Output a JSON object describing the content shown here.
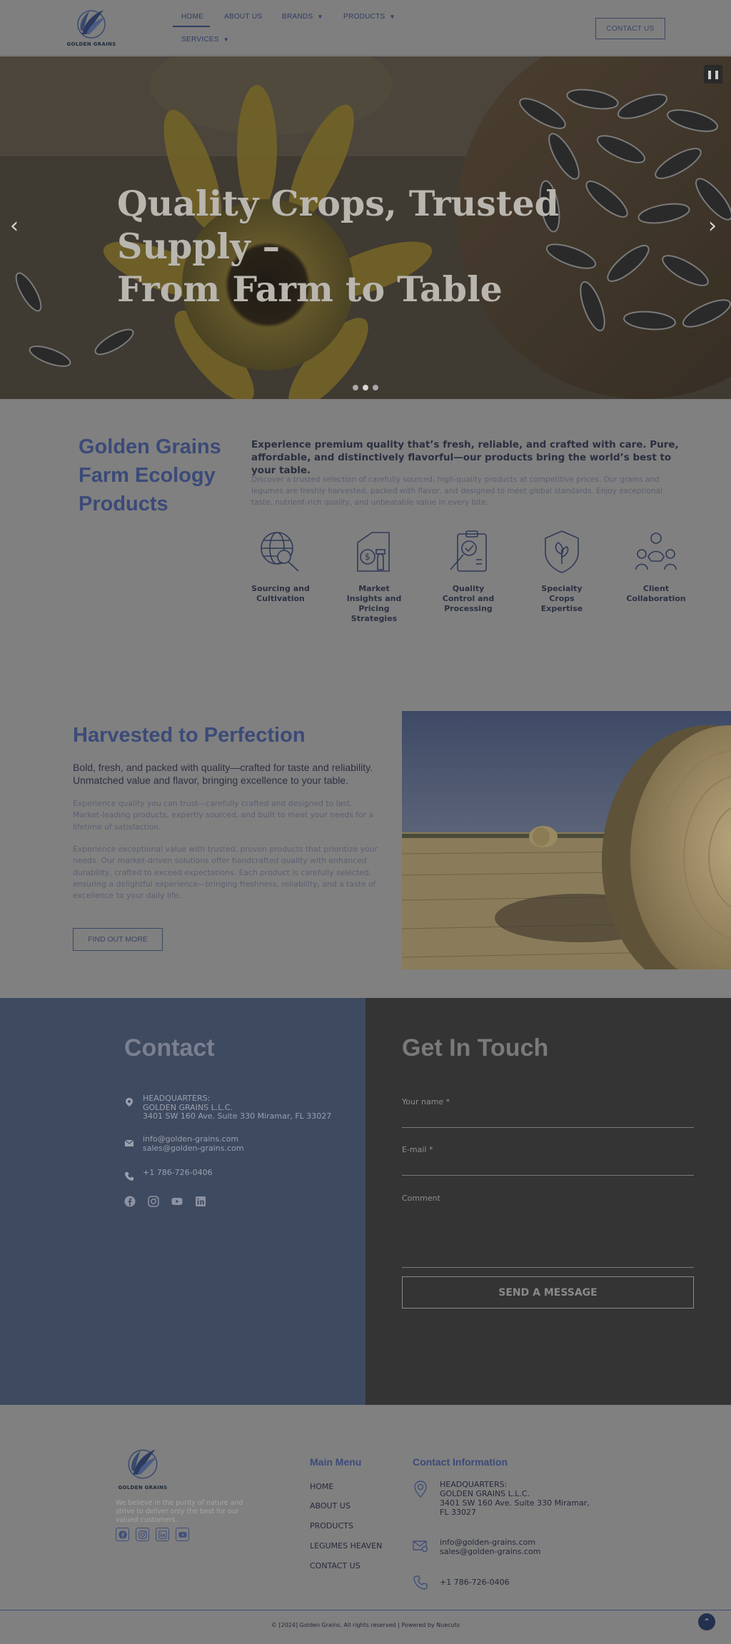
{
  "brand": {
    "name": "GOLDEN GRAINS"
  },
  "nav": {
    "items": [
      {
        "label": "HOME",
        "active": true,
        "has_dropdown": false
      },
      {
        "label": "ABOUT US",
        "has_dropdown": false
      },
      {
        "label": "BRANDS",
        "has_dropdown": true
      },
      {
        "label": "PRODUCTS",
        "has_dropdown": true
      },
      {
        "label": "SERVICES",
        "has_dropdown": true
      }
    ],
    "contact_button": "CONTACT US"
  },
  "hero": {
    "title_line1": "Quality Crops, Trusted Supply –",
    "title_line2": "From Farm to Table",
    "pause_icon": "pause-icon",
    "slides": 3,
    "active_slide": 2
  },
  "about": {
    "heading_line1": "Golden Grains",
    "heading_line2": "Farm Ecology",
    "heading_line3": "Products",
    "lead": "Experience premium quality that’s fresh, reliable, and crafted with care. Pure, affordable, and distinctively flavorful—our products bring the world’s best to your table.",
    "body": "Discover a trusted selection of carefully sourced, high-quality products at competitive prices. Our grains and legumes are freshly harvested, packed with flavor, and designed to meet global standards. Enjoy exceptional taste, nutrient-rich quality, and unbeatable value in every bite.",
    "features": [
      {
        "label": "Sourcing and Cultivation",
        "icon": "globe-sourcing-icon"
      },
      {
        "label": "Market Insights and Pricing Strategies",
        "icon": "market-strategy-icon"
      },
      {
        "label": "Quality Control and Processing",
        "icon": "quality-checklist-icon"
      },
      {
        "label": "Specialty Crops Expertise",
        "icon": "shield-leaf-icon"
      },
      {
        "label": "Client Collaboration",
        "icon": "client-collaboration-icon"
      }
    ]
  },
  "harvest": {
    "title": "Harvested to Perfection",
    "subtitle": "Bold, fresh, and packed with quality—crafted for taste and reliability. Unmatched value and flavor, bringing excellence to your table.",
    "paragraph1": "Experience quality you can trust—carefully crafted and designed to last. Market-leading products, expertly sourced, and built to meet your needs for a lifetime of satisfaction.",
    "paragraph2": "Experience exceptional value with trusted, proven products that prioritize your needs. Our market-driven solutions offer handcrafted quality with enhanced durability, crafted to exceed expectations. Each product is carefully selected, ensuring a delightful experience—bringing freshness, reliability, and a taste of excellence to your daily life.",
    "button": "FIND OUT MORE"
  },
  "contact": {
    "title": "Contact",
    "hq_label": "HEADQUARTERS:",
    "hq_company": "GOLDEN GRAINS L.L.C.",
    "hq_address": "3401 SW 160 Ave. Suite 330 Miramar, FL 33027",
    "email1": "info@golden-grains.com",
    "email2": "sales@golden-grains.com",
    "phone": "+1 786-726-0406",
    "socials": [
      "facebook-icon",
      "instagram-icon",
      "youtube-icon",
      "linkedin-icon"
    ]
  },
  "form": {
    "title": "Get In Touch",
    "name_label": "Your name *",
    "email_label": "E-mail *",
    "comment_label": "Comment",
    "submit": "SEND A MESSAGE"
  },
  "footer": {
    "tagline": "We believe in the purity of nature and strive to deliver only the best for our valued customers.",
    "socials": [
      "facebook-icon",
      "instagram-icon",
      "linkedin-icon",
      "youtube-icon"
    ],
    "menu_heading": "Main Menu",
    "menu_items": [
      "HOME",
      "ABOUT US",
      "PRODUCTS",
      "LEGUMES HEAVEN",
      "CONTACT US"
    ],
    "info_heading": "Contact Information",
    "hq_label": "HEADQUARTERS:",
    "hq_company": "GOLDEN GRAINS L.L.C.",
    "hq_address": "3401 SW 160 Ave. Suite 330 Miramar, FL 33027",
    "email1": "info@golden-grains.com",
    "email2": "sales@golden-grains.com",
    "phone": "+1 786-726-0406",
    "copyright": "© [2024] Golden Grains. All rights reserved | Powered by Nuecuts"
  },
  "colors": {
    "accent_navy": "#3b4a78",
    "contact_panel": "#3e4a60",
    "form_panel": "#343434",
    "overlay_gray": "#808080"
  }
}
